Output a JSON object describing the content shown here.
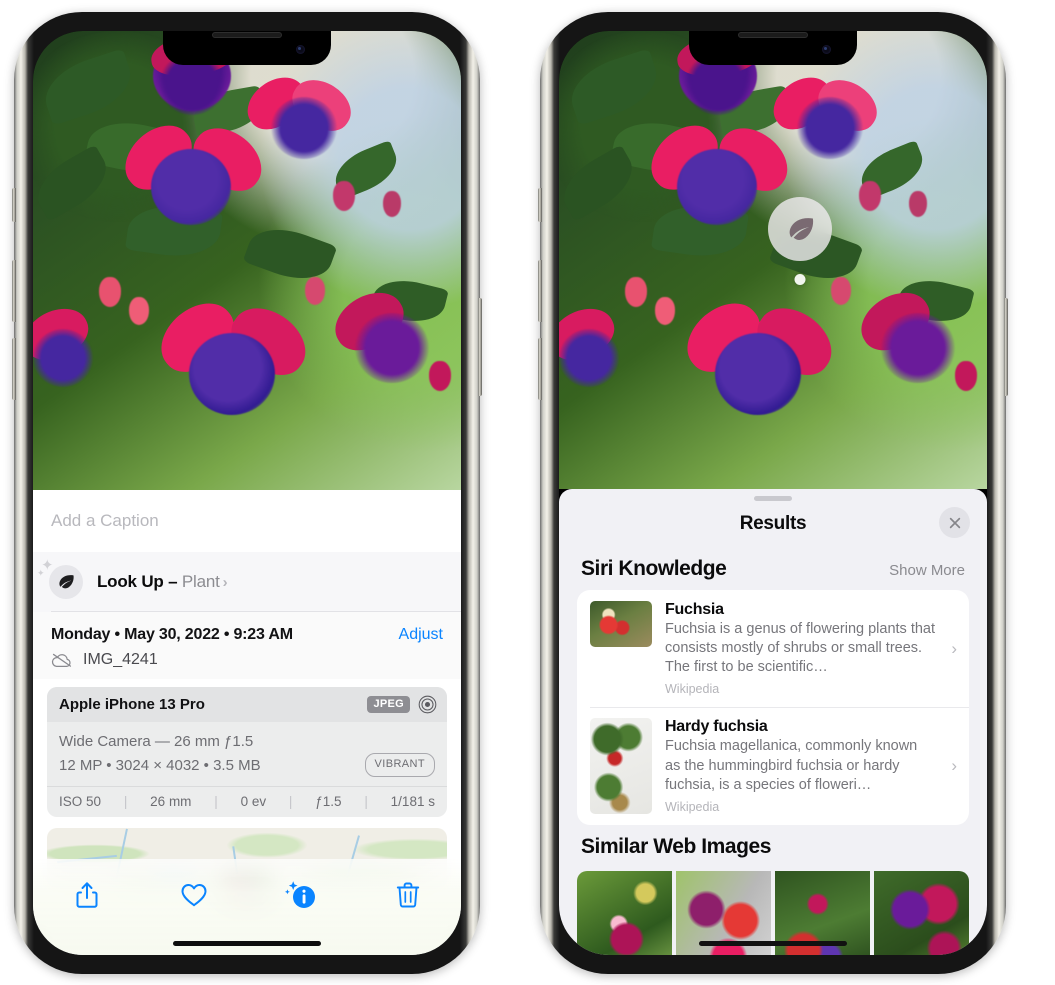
{
  "left_phone": {
    "photo": {
      "alt_name": "fuchsia-flowers-photo"
    },
    "caption_placeholder": "Add a Caption",
    "lookup": {
      "icon": "leaf-icon",
      "label": "Look Up – ",
      "subject": "Plant",
      "chevron": "›"
    },
    "metadata": {
      "date": "Monday • May 30, 2022 • 9:23 AM",
      "adjust_label": "Adjust",
      "cloud_icon": "cloud-slash-icon",
      "filename": "IMG_4241"
    },
    "camera": {
      "device": "Apple iPhone 13 Pro",
      "format_badge": "JPEG",
      "lens_icon": "lens-icon",
      "lens_line": "Wide Camera — 26 mm ƒ1.5",
      "size_line": "12 MP • 3024 × 4032 • 3.5 MB",
      "style_badge": "VIBRANT",
      "exif": [
        "ISO 50",
        "26 mm",
        "0 ev",
        "ƒ1.5",
        "1/181 s"
      ]
    },
    "map": {
      "name": "photo-location-map"
    },
    "toolbar": [
      {
        "name": "share-button",
        "icon": "share-icon"
      },
      {
        "name": "favorite-button",
        "icon": "heart-icon"
      },
      {
        "name": "info-button",
        "icon": "info-sparkle-icon",
        "active": true
      },
      {
        "name": "delete-button",
        "icon": "trash-icon"
      }
    ],
    "accent_color": "#0a84ff"
  },
  "right_phone": {
    "visual_lookup_pin": {
      "icon": "leaf-icon"
    },
    "sheet": {
      "title": "Results",
      "close_label": "✕",
      "siri_knowledge": {
        "heading": "Siri Knowledge",
        "show_more": "Show More",
        "cards": [
          {
            "title": "Fuchsia",
            "description": "Fuchsia is a genus of flowering plants that consists mostly of shrubs or small trees. The first to be scientific…",
            "source": "Wikipedia",
            "chevron": "›"
          },
          {
            "title": "Hardy fuchsia",
            "description": "Fuchsia magellanica, commonly known as the hummingbird fuchsia or hardy fuchsia, is a species of floweri…",
            "source": "Wikipedia",
            "chevron": "›"
          }
        ]
      },
      "similar_web_images": {
        "heading": "Similar Web Images",
        "count": 4
      }
    }
  }
}
